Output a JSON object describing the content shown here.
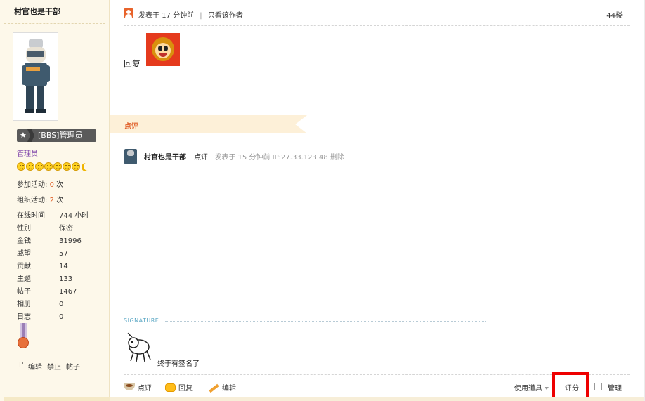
{
  "profile": {
    "username": "村官也是干部",
    "badge": "[BBS]管理员",
    "group": "管理员",
    "activity_join_label": "参加活动:",
    "activity_join_num": "0",
    "activity_join_unit": "次",
    "activity_org_label": "组织活动:",
    "activity_org_num": "2",
    "activity_org_unit": "次",
    "stats": [
      {
        "k": "在线时间",
        "v": "744 小时"
      },
      {
        "k": "性别",
        "v": "保密"
      },
      {
        "k": "金钱",
        "v": "31996"
      },
      {
        "k": "威望",
        "v": "57"
      },
      {
        "k": "贡献",
        "v": "14"
      },
      {
        "k": "主题",
        "v": "133"
      },
      {
        "k": "帖子",
        "v": "1467"
      },
      {
        "k": "相册",
        "v": "0"
      },
      {
        "k": "日志",
        "v": "0"
      }
    ],
    "links": [
      "IP",
      "编辑",
      "禁止",
      "帖子"
    ]
  },
  "post": {
    "posted_label": "发表于",
    "posted_time": "17 分钟前",
    "only_author": "只看该作者",
    "floor": "44楼",
    "content": "回复"
  },
  "comment_section": {
    "title": "点评",
    "author": "村官也是干部",
    "keyword": "点评",
    "meta": "发表于  15 分钟前 IP:27.33.123.48 删除"
  },
  "signature": {
    "label": "SIGNATURE",
    "text": "终于有签名了"
  },
  "actions": {
    "comment": "点评",
    "reply": "回复",
    "edit": "编辑",
    "tools": "使用道具",
    "rate": "评分",
    "manage": "管理"
  },
  "colors": {
    "accent_orange": "#e0602a",
    "left_panel_bg": "#fdf8ea",
    "highlight_box": "#ee0000",
    "group_purple": "#7b3fa8"
  }
}
